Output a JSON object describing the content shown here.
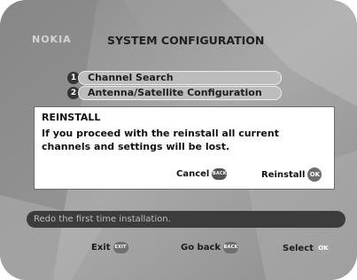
{
  "brand": "NOKIA",
  "header": {
    "title": "SYSTEM CONFIGURATION"
  },
  "menu": [
    {
      "number": "1",
      "label": "Channel Search"
    },
    {
      "number": "2",
      "label": "Antenna/Satellite Configuration"
    }
  ],
  "dialog": {
    "title": "REINSTALL",
    "message": "If you proceed with the reinstall all current channels and settings will be lost.",
    "cancel_label": "Cancel",
    "cancel_key": "BACK",
    "confirm_label": "Reinstall",
    "confirm_key": "OK"
  },
  "help_text": "Redo the first time installation.",
  "footer": {
    "exit_label": "Exit",
    "exit_key": "EXIT",
    "back_label": "Go back",
    "back_key": "BACK",
    "select_label": "Select",
    "select_key": "OK"
  },
  "colors": {
    "screen_background": "#9c9c9c",
    "dialog_background": "#ffffff",
    "help_bar": "#3c3c3c"
  }
}
